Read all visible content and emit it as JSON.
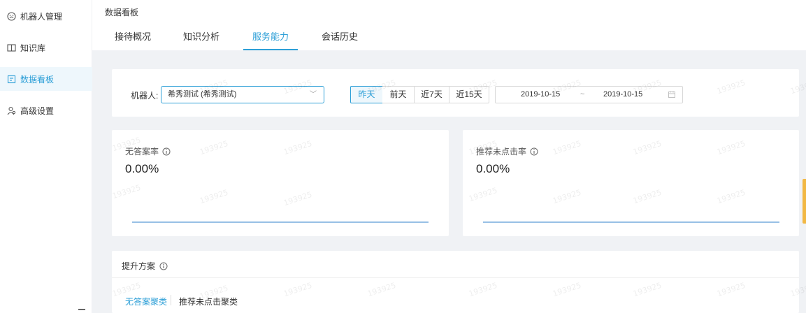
{
  "sidebar": {
    "items": [
      {
        "label": "机器人管理",
        "icon": "robot-icon"
      },
      {
        "label": "知识库",
        "icon": "book-icon"
      },
      {
        "label": "数据看板",
        "icon": "dashboard-icon",
        "active": true
      },
      {
        "label": "高级设置",
        "icon": "user-settings-icon"
      }
    ]
  },
  "header": {
    "title": "数据看板",
    "tabs": [
      {
        "label": "接待概况"
      },
      {
        "label": "知识分析"
      },
      {
        "label": "服务能力",
        "active": true
      },
      {
        "label": "会话历史"
      }
    ]
  },
  "filter": {
    "robot_label": "机器人:",
    "robot_value": "希秀测试 (希秀测试)",
    "ranges": [
      "昨天",
      "前天",
      "近7天",
      "近15天"
    ],
    "active_range": "昨天",
    "start_date": "2019-10-15",
    "range_sep": "~",
    "end_date": "2019-10-15"
  },
  "metrics": [
    {
      "label": "无答案率",
      "value": "0.00%",
      "trend": [
        0,
        0,
        0,
        0,
        0,
        0,
        0
      ]
    },
    {
      "label": "推荐未点击率",
      "value": "0.00%",
      "trend": [
        0,
        0,
        0,
        0,
        0,
        0,
        0
      ]
    }
  ],
  "plan": {
    "title": "提升方案",
    "tabs": [
      {
        "label": "无答案聚类",
        "active": true
      },
      {
        "label": "推荐未点击聚类"
      }
    ]
  },
  "watermark": "193925",
  "colors": {
    "accent": "#2d9fd7",
    "line": "#5b9bd5",
    "side_marker": "#f2b844"
  }
}
